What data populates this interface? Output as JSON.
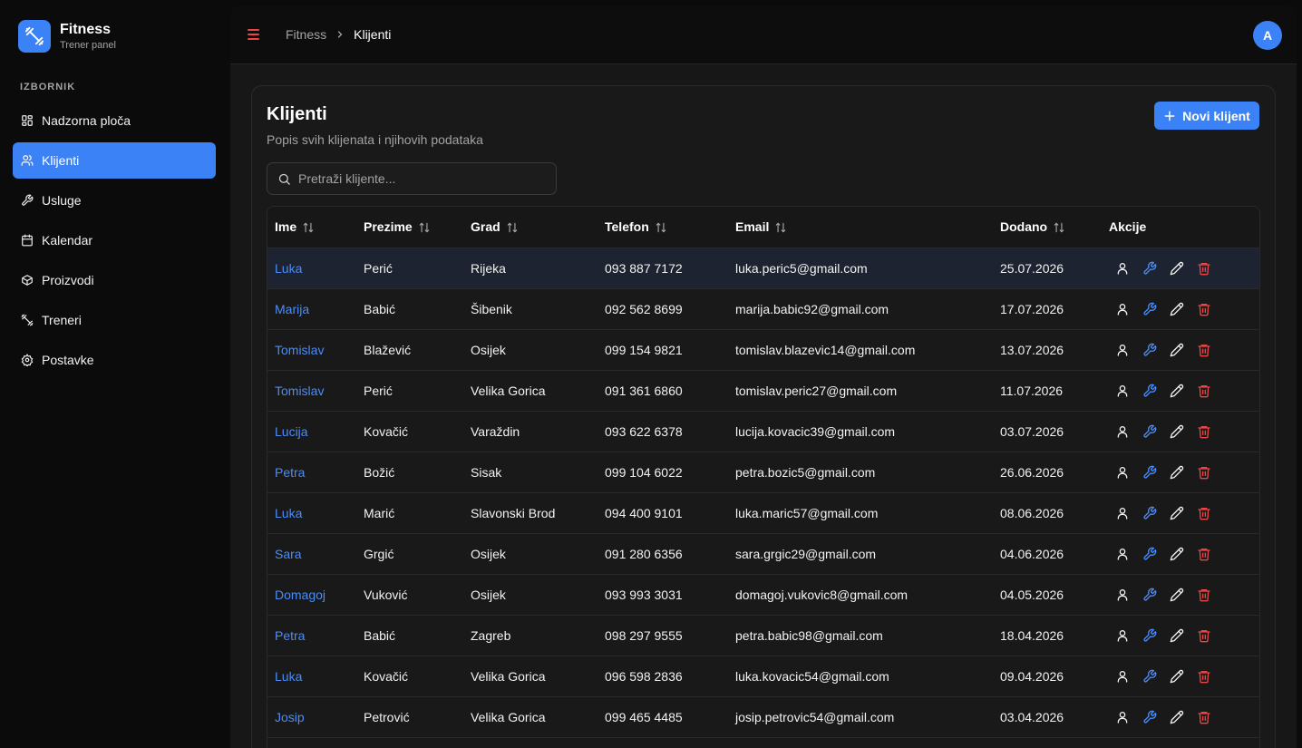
{
  "brand": {
    "name": "Fitness",
    "subtitle": "Trener panel",
    "accent": "#3b82f6"
  },
  "sidebar": {
    "heading": "IZBORNIK",
    "items": [
      {
        "label": "Nadzorna ploča",
        "icon": "dashboard-icon",
        "active": false
      },
      {
        "label": "Klijenti",
        "icon": "users-icon",
        "active": true
      },
      {
        "label": "Usluge",
        "icon": "wrench-icon",
        "active": false
      },
      {
        "label": "Kalendar",
        "icon": "calendar-icon",
        "active": false
      },
      {
        "label": "Proizvodi",
        "icon": "box-icon",
        "active": false
      },
      {
        "label": "Treneri",
        "icon": "dumbbell-icon",
        "active": false
      },
      {
        "label": "Postavke",
        "icon": "gear-icon",
        "active": false
      }
    ]
  },
  "topbar": {
    "breadcrumb": {
      "root": "Fitness",
      "current": "Klijenti"
    },
    "avatar_initial": "A"
  },
  "page": {
    "title": "Klijenti",
    "subtitle": "Popis svih klijenata i njihovih podataka",
    "new_button": "Novi klijent",
    "search_placeholder": "Pretraži klijente..."
  },
  "table": {
    "columns": [
      "Ime",
      "Prezime",
      "Grad",
      "Telefon",
      "Email",
      "Dodano",
      "Akcije"
    ],
    "rows": [
      {
        "ime": "Luka",
        "prezime": "Perić",
        "grad": "Rijeka",
        "telefon": "093 887 7172",
        "email": "luka.peric5@gmail.com",
        "dodano": "25.07.2026"
      },
      {
        "ime": "Marija",
        "prezime": "Babić",
        "grad": "Šibenik",
        "telefon": "092 562 8699",
        "email": "marija.babic92@gmail.com",
        "dodano": "17.07.2026"
      },
      {
        "ime": "Tomislav",
        "prezime": "Blažević",
        "grad": "Osijek",
        "telefon": "099 154 9821",
        "email": "tomislav.blazevic14@gmail.com",
        "dodano": "13.07.2026"
      },
      {
        "ime": "Tomislav",
        "prezime": "Perić",
        "grad": "Velika Gorica",
        "telefon": "091 361 6860",
        "email": "tomislav.peric27@gmail.com",
        "dodano": "11.07.2026"
      },
      {
        "ime": "Lucija",
        "prezime": "Kovačić",
        "grad": "Varaždin",
        "telefon": "093 622 6378",
        "email": "lucija.kovacic39@gmail.com",
        "dodano": "03.07.2026"
      },
      {
        "ime": "Petra",
        "prezime": "Božić",
        "grad": "Sisak",
        "telefon": "099 104 6022",
        "email": "petra.bozic5@gmail.com",
        "dodano": "26.06.2026"
      },
      {
        "ime": "Luka",
        "prezime": "Marić",
        "grad": "Slavonski Brod",
        "telefon": "094 400 9101",
        "email": "luka.maric57@gmail.com",
        "dodano": "08.06.2026"
      },
      {
        "ime": "Sara",
        "prezime": "Grgić",
        "grad": "Osijek",
        "telefon": "091 280 6356",
        "email": "sara.grgic29@gmail.com",
        "dodano": "04.06.2026"
      },
      {
        "ime": "Domagoj",
        "prezime": "Vuković",
        "grad": "Osijek",
        "telefon": "093 993 3031",
        "email": "domagoj.vukovic8@gmail.com",
        "dodano": "04.05.2026"
      },
      {
        "ime": "Petra",
        "prezime": "Babić",
        "grad": "Zagreb",
        "telefon": "098 297 9555",
        "email": "petra.babic98@gmail.com",
        "dodano": "18.04.2026"
      },
      {
        "ime": "Luka",
        "prezime": "Kovačić",
        "grad": "Velika Gorica",
        "telefon": "096 598 2836",
        "email": "luka.kovacic54@gmail.com",
        "dodano": "09.04.2026"
      },
      {
        "ime": "Josip",
        "prezime": "Petrović",
        "grad": "Velika Gorica",
        "telefon": "099 465 4485",
        "email": "josip.petrovic54@gmail.com",
        "dodano": "03.04.2026"
      }
    ],
    "row_actions": [
      "user-icon",
      "wrench-icon",
      "pencil-icon",
      "trash-icon"
    ]
  },
  "colors": {
    "accent": "#3b82f6",
    "link": "#4c8cf7",
    "danger": "#ef4444"
  }
}
